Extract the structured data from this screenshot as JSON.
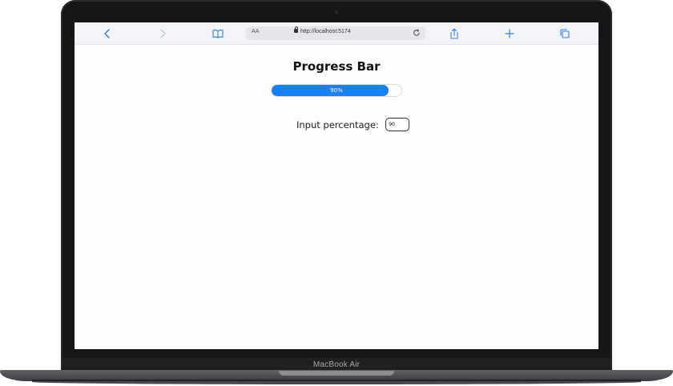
{
  "device": {
    "brand_label": "MacBook Air"
  },
  "browser": {
    "text_size_label": "AA",
    "url": "http://localhost:5174",
    "icons": {
      "back": "chevron-left-icon",
      "forward": "chevron-right-icon",
      "bookmarks": "book-icon",
      "lock": "lock-icon",
      "reload": "reload-icon",
      "share": "share-icon",
      "new_tab": "plus-icon",
      "tabs": "tabs-icon"
    },
    "accent_color": "#2f7ff0"
  },
  "page": {
    "title": "Progress Bar",
    "progress": {
      "value_percent": 90,
      "label": "90%",
      "fill_color": "#1780f5"
    },
    "input": {
      "label": "Input percentage:",
      "value": "90"
    }
  }
}
